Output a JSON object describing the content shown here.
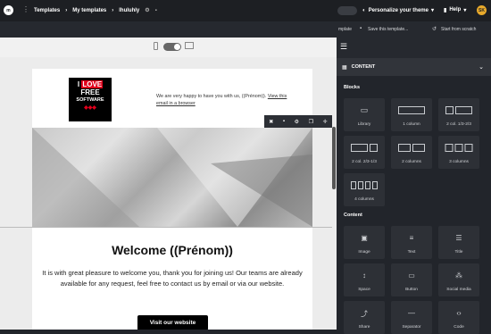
{
  "topbar": {
    "logo_text": "m",
    "breadcrumb": [
      "Templates",
      "My templates",
      "lhuluhly"
    ],
    "personalize": "Personalize your theme",
    "help": "Help",
    "avatar": "SK"
  },
  "toolbar": {
    "template_trunc": "mplate",
    "save": "Save this template...",
    "start": "Start from scratch"
  },
  "email": {
    "logo_lines": [
      "I",
      "LOVE",
      "FREE",
      "SOFTWARE"
    ],
    "preheader": "We are very happy to have you with us, ((Prénom)).",
    "preheader_link1": "View this",
    "preheader_link2": "email in a browser",
    "title": "Welcome ((Prénom))",
    "body": "It is with great pleasure to welcome you, thank you for joining us! Our teams are already available for any request, feel free to contact us by email or via our website.",
    "cta": "Visit our website"
  },
  "panel": {
    "header": "CONTENT",
    "blocks_title": "Blocks",
    "blocks": [
      "Library",
      "1 column",
      "2 col. 1/3-2/3",
      "2 col. 2/3-1/3",
      "2 columns",
      "3 columns",
      "4 columns"
    ],
    "content_title": "Content",
    "content": [
      "Image",
      "Text",
      "Title",
      "Space",
      "Button",
      "Social media",
      "Share",
      "Separator",
      "Code"
    ]
  },
  "colors": {
    "accent": "#e0001b",
    "bg_dark": "#22252b",
    "tile": "#2d3036"
  }
}
